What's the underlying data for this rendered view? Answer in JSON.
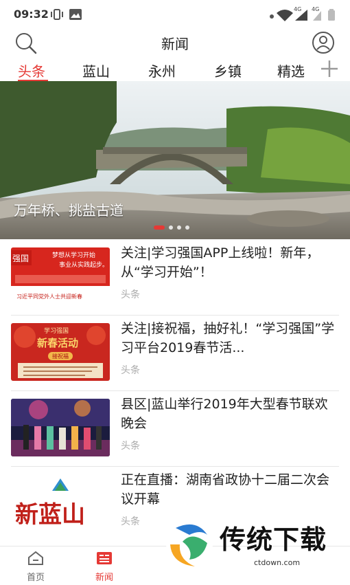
{
  "status_bar": {
    "time": "09:32",
    "net1": "4G",
    "net2": "4G"
  },
  "header": {
    "title": "新闻"
  },
  "tabs": [
    {
      "label": "头条",
      "active": true
    },
    {
      "label": "蓝山",
      "active": false
    },
    {
      "label": "永州",
      "active": false
    },
    {
      "label": "乡镇",
      "active": false
    },
    {
      "label": "精选",
      "active": false
    }
  ],
  "banner": {
    "caption": "万年桥、挑盐古道",
    "slides": 4,
    "active_slide": 1
  },
  "news": [
    {
      "title": "关注|学习强国APP上线啦！新年，从“学习开始”！",
      "tag": "头条",
      "thumb": {
        "logo": "强国",
        "line1": "梦想从学习开始",
        "line2": "事业从实践起步。",
        "footer": "习近平同党外人士共迎新春"
      }
    },
    {
      "title": "关注|接祝福，抽好礼！“学习强国”学习平台2019春节活...",
      "tag": "头条",
      "thumb": {
        "top": "学习强国",
        "main": "新春活动",
        "badge": "接祝福"
      }
    },
    {
      "title": "县区|蓝山举行2019年大型春节联欢晚会",
      "tag": "头条",
      "thumb": {}
    },
    {
      "title": "正在直播：湖南省政协十二届二次会议开幕",
      "tag": "头条",
      "thumb": {
        "calligraphy": "新蓝山"
      }
    }
  ],
  "bottom_nav": [
    {
      "label": "首页",
      "icon": "home-icon",
      "active": false
    },
    {
      "label": "新闻",
      "icon": "news-icon",
      "active": true
    }
  ],
  "watermark": {
    "brand": "传统下载",
    "url": "ctdown.com"
  },
  "colors": {
    "accent": "#e53935",
    "muted": "#aaaaaa"
  }
}
